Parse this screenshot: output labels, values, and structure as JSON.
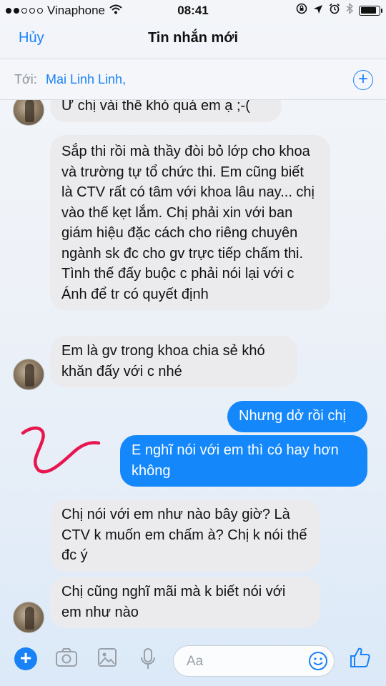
{
  "status_bar": {
    "carrier": "Vinaphone",
    "time": "08:41",
    "battery_level_percent": 88
  },
  "nav": {
    "cancel_label": "Hủy",
    "title": "Tin nhắn mới"
  },
  "to_row": {
    "label": "Tới:",
    "recipient": "Mai Linh Linh,"
  },
  "messages": [
    {
      "direction": "in",
      "text": "Ư chị vài thê khó quá em ạ ;-("
    },
    {
      "direction": "in",
      "text": "Sắp thi rồi mà thầy đòi bỏ lớp cho khoa và trường tự tổ chức thi. Em cũng biết là CTV rất có tâm với khoa lâu nay... chị vào thế kẹt lắm. Chị phải xin với ban giám hiệu đặc cách cho riêng chuyên ngành sk đc cho gv trực tiếp chấm thi. Tình thế đấy buộc c phải nói lại với c Ánh để tr có quyết định"
    },
    {
      "direction": "in",
      "text": "Em là gv trong khoa chia sẻ khó khăn đấy với c nhé"
    },
    {
      "direction": "out",
      "text": "Nhưng dở rồi chị"
    },
    {
      "direction": "out",
      "text": "E nghĩ nói với em thì có hay hơn không"
    },
    {
      "direction": "in",
      "text": "Chị nói với em như nào bây giờ? Là CTV k muốn em chấm à? Chị k nói thế đc ý"
    },
    {
      "direction": "in",
      "text": "Chị cũng nghĩ mãi mà k biết nói với em như nào"
    }
  ],
  "composer": {
    "placeholder": "Aa",
    "icons": [
      "add-icon",
      "camera-icon",
      "photo-icon",
      "microphone-icon",
      "emoji-icon",
      "thumbs-up-icon"
    ]
  },
  "colors": {
    "accent": "#1a82f7",
    "outgoing_bubble": "#1487fb",
    "incoming_bubble": "#ebebee",
    "annotation": "#e8154f"
  }
}
